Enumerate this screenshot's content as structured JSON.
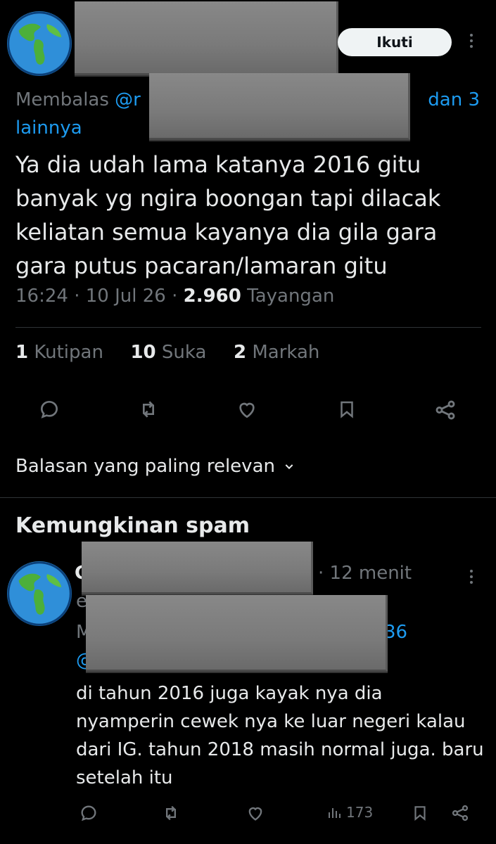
{
  "tweet": {
    "follow_label": "Ikuti",
    "reply_prefix": "Membalas ",
    "reply_handle_start": "@r",
    "reply_suffix": "dan 3",
    "reply_suffix2": "lainnya",
    "text": "Ya dia udah lama katanya 2016 gitu banyak yg ngira boongan tapi dilacak keliatan semua kayanya dia gila gara gara putus pacaran/lamaran gitu",
    "time": "16:24",
    "date": "10 Jul 26",
    "views_count": "2.960",
    "views_label": "Tayangan",
    "stats": {
      "quotes_count": "1",
      "quotes_label": "Kutipan",
      "likes_count": "10",
      "likes_label": "Suka",
      "bookmarks_count": "2",
      "bookmarks_label": "Markah"
    }
  },
  "sort_label": "Balasan yang paling relevan",
  "spam_heading": "Kemungkinan spam",
  "reply": {
    "time": "· 12 menit",
    "partial_name": "C",
    "partial_handle": "e",
    "partial_reply_prefix": "M",
    "partial_reply_end": "36",
    "partial_at": "@",
    "text": "di tahun 2016 juga kayak nya dia nyamperin cewek nya ke luar negeri kalau dari IG. tahun 2018 masih normal juga. baru setelah itu",
    "views": "173"
  },
  "colors": {
    "background": "#000000",
    "text": "#e7e9ea",
    "muted": "#71767b",
    "link": "#1d9bf0"
  },
  "icons": [
    "globe-avatar",
    "more-icon",
    "reply-icon",
    "retweet-icon",
    "like-icon",
    "bookmark-icon",
    "share-icon",
    "chevron-down-icon",
    "views-icon"
  ]
}
